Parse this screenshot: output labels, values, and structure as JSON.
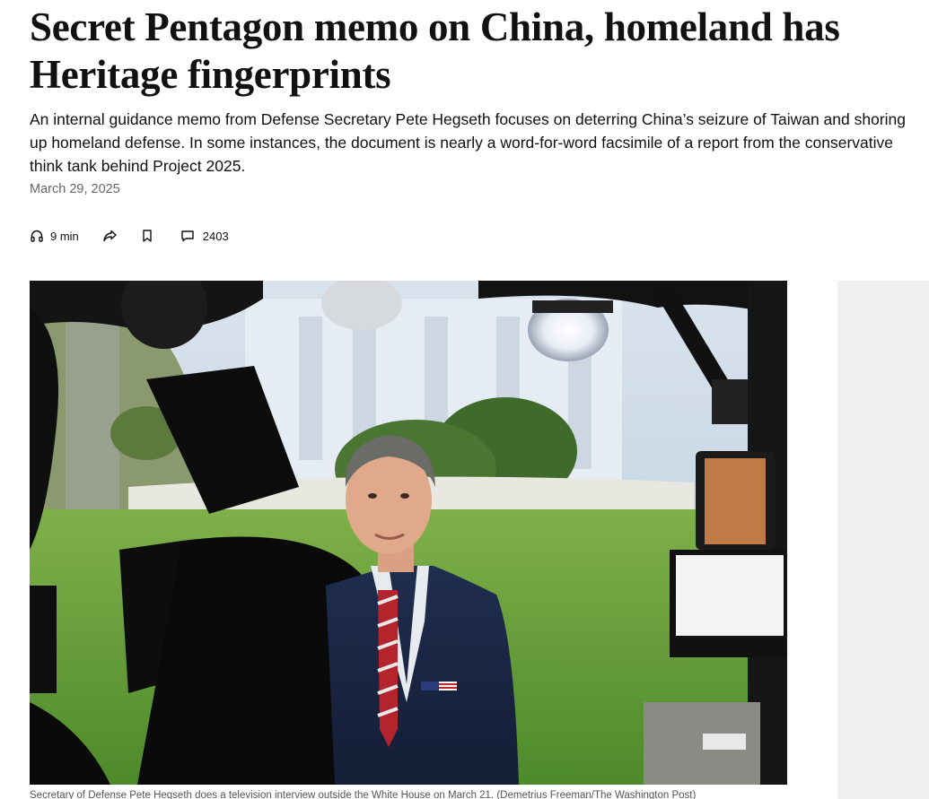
{
  "article": {
    "headline": "Secret Pentagon memo on China, homeland has Heritage fingerprints",
    "dek": "An internal guidance memo from Defense Secretary Pete Hegseth focuses on deterring China’s seizure of Taiwan and shoring up homeland defense. In some instances, the document is nearly a word-for-word facsimile of a report from the conservative think tank behind Project 2025.",
    "date": "March 29, 2025"
  },
  "actions": {
    "listen_label": "9 min",
    "listen_icon": "headphones-icon",
    "share_icon": "share-icon",
    "save_icon": "bookmark-icon",
    "comments_count": "2403",
    "comments_icon": "comment-icon"
  },
  "photo": {
    "caption": "Secretary of Defense Pete Hegseth does a television interview outside the White House on March 21. (Demetrius Freeman/The Washington Post)"
  },
  "colors": {
    "text": "#111111",
    "meta": "#666666",
    "ad_background": "#f0f0f0"
  }
}
